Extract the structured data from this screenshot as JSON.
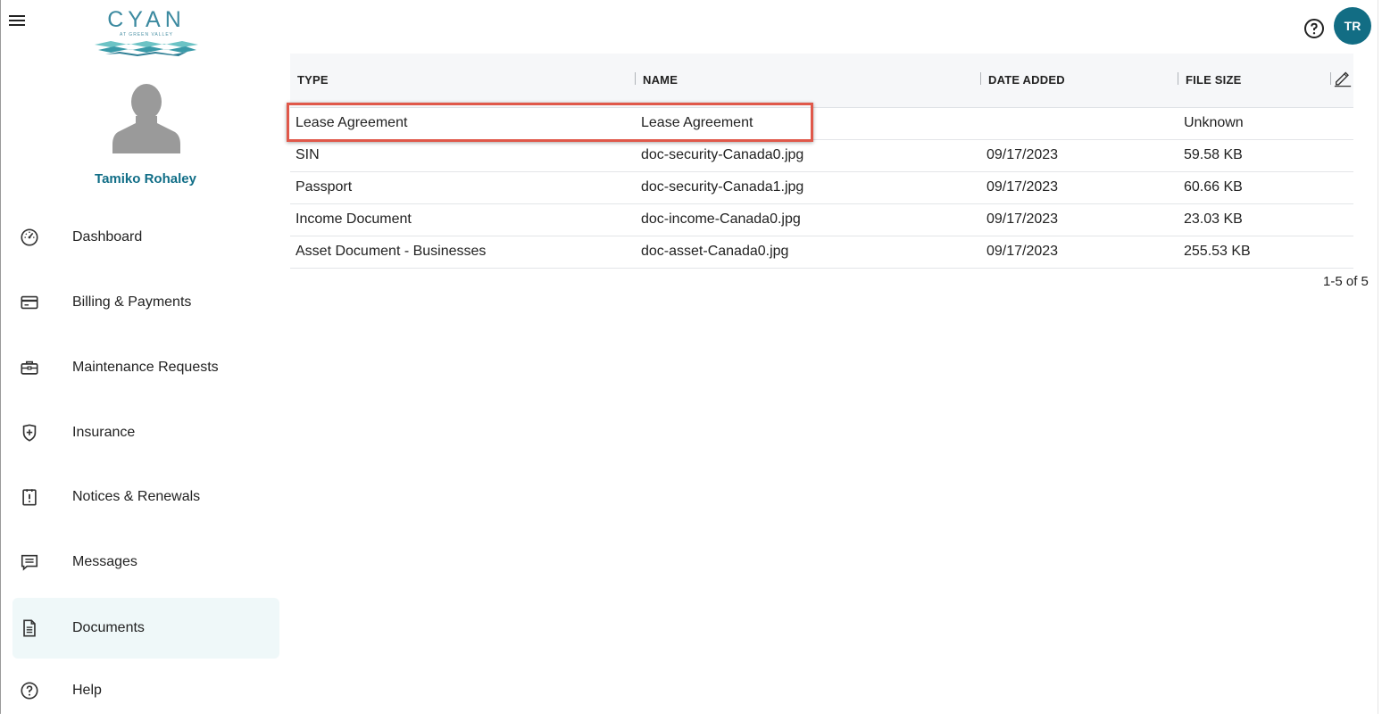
{
  "brand": {
    "logo_text": "CYAN",
    "logo_sub": "AT GREEN VALLEY"
  },
  "user": {
    "name": "Tamiko Rohaley",
    "initials": "TR"
  },
  "nav": [
    {
      "label": "Dashboard",
      "icon": "gauge-icon"
    },
    {
      "label": "Billing & Payments",
      "icon": "credit-card-icon"
    },
    {
      "label": "Maintenance Requests",
      "icon": "toolbox-icon"
    },
    {
      "label": "Insurance",
      "icon": "shield-plus-icon"
    },
    {
      "label": "Notices & Renewals",
      "icon": "clipboard-alert-icon"
    },
    {
      "label": "Messages",
      "icon": "message-icon"
    },
    {
      "label": "Documents",
      "icon": "document-icon",
      "active": true
    },
    {
      "label": "Help",
      "icon": "help-circle-icon"
    }
  ],
  "table": {
    "headers": {
      "type": "TYPE",
      "name": "NAME",
      "date_added": "DATE ADDED",
      "file_size": "FILE SIZE"
    },
    "rows": [
      {
        "type": "Lease Agreement",
        "name": "Lease Agreement",
        "date": "",
        "size": "Unknown"
      },
      {
        "type": "SIN",
        "name": "doc-security-Canada0.jpg",
        "date": "09/17/2023",
        "size": "59.58 KB"
      },
      {
        "type": "Passport",
        "name": "doc-security-Canada1.jpg",
        "date": "09/17/2023",
        "size": "60.66 KB"
      },
      {
        "type": "Income Document",
        "name": "doc-income-Canada0.jpg",
        "date": "09/17/2023",
        "size": "23.03 KB"
      },
      {
        "type": "Asset Document - Businesses",
        "name": "doc-asset-Canada0.jpg",
        "date": "09/17/2023",
        "size": "255.53 KB"
      }
    ],
    "pagination": "1-5 of 5"
  },
  "colors": {
    "accent": "#116e87",
    "avatar_bg": "#126d84",
    "highlight": "#e0584a",
    "active_nav_bg": "#eff8f9"
  }
}
